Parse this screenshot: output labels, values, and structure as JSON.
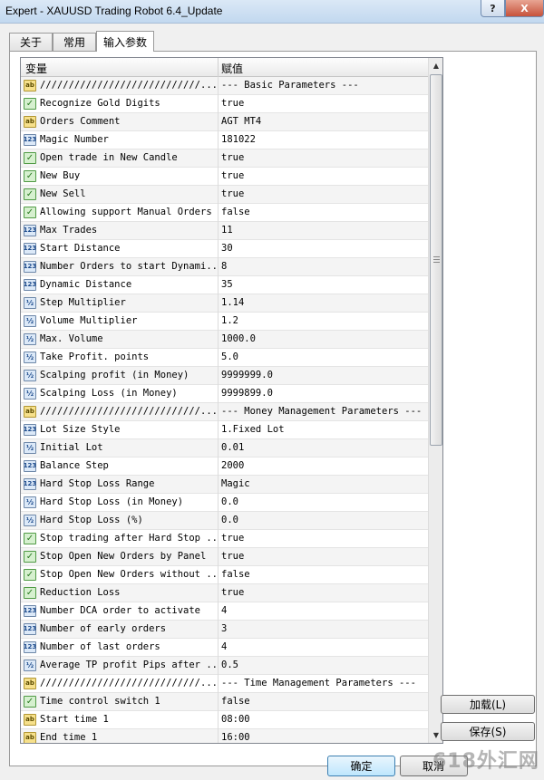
{
  "window": {
    "title": "Expert - XAUUSD Trading Robot 6.4_Update",
    "help_label": "?",
    "close_label": "X"
  },
  "tabs": [
    {
      "label": "关于"
    },
    {
      "label": "常用"
    },
    {
      "label": "输入参数"
    }
  ],
  "table": {
    "columns": [
      "变量",
      "赋值"
    ],
    "rows": [
      {
        "type": "ab",
        "icon": "ab",
        "name": "////////////////////////////...",
        "value": "--- Basic Parameters ---"
      },
      {
        "type": "bool",
        "icon": "✓",
        "name": "Recognize Gold Digits",
        "value": "true"
      },
      {
        "type": "ab",
        "icon": "ab",
        "name": "Orders Comment",
        "value": "AGT MT4"
      },
      {
        "type": "int",
        "icon": "123",
        "name": "Magic Number",
        "value": "181022"
      },
      {
        "type": "bool",
        "icon": "✓",
        "name": "Open trade in New Candle",
        "value": "true"
      },
      {
        "type": "bool",
        "icon": "✓",
        "name": "New Buy",
        "value": "true"
      },
      {
        "type": "bool",
        "icon": "✓",
        "name": "New Sell",
        "value": "true"
      },
      {
        "type": "bool",
        "icon": "✓",
        "name": "Allowing support Manual Orders",
        "value": "false"
      },
      {
        "type": "int",
        "icon": "123",
        "name": "Max Trades",
        "value": "11"
      },
      {
        "type": "int",
        "icon": "123",
        "name": "Start Distance",
        "value": "30"
      },
      {
        "type": "int",
        "icon": "123",
        "name": "Number Orders to start Dynami...",
        "value": "8"
      },
      {
        "type": "int",
        "icon": "123",
        "name": "Dynamic Distance",
        "value": "35"
      },
      {
        "type": "dbl",
        "icon": "½",
        "name": "Step Multiplier",
        "value": "1.14"
      },
      {
        "type": "dbl",
        "icon": "½",
        "name": "Volume Multiplier",
        "value": "1.2"
      },
      {
        "type": "dbl",
        "icon": "½",
        "name": "Max. Volume",
        "value": "1000.0"
      },
      {
        "type": "dbl",
        "icon": "½",
        "name": "Take Profit. points",
        "value": "5.0"
      },
      {
        "type": "dbl",
        "icon": "½",
        "name": "Scalping profit (in Money)",
        "value": "9999999.0"
      },
      {
        "type": "dbl",
        "icon": "½",
        "name": "Scalping Loss (in Money)",
        "value": "9999899.0"
      },
      {
        "type": "ab",
        "icon": "ab",
        "name": "////////////////////////////...",
        "value": "--- Money Management Parameters ---"
      },
      {
        "type": "int",
        "icon": "123",
        "name": "Lot Size Style",
        "value": "1.Fixed Lot"
      },
      {
        "type": "dbl",
        "icon": "½",
        "name": "Initial Lot",
        "value": "0.01"
      },
      {
        "type": "int",
        "icon": "123",
        "name": "Balance Step",
        "value": "2000"
      },
      {
        "type": "int",
        "icon": "123",
        "name": "Hard Stop Loss Range",
        "value": "Magic"
      },
      {
        "type": "dbl",
        "icon": "½",
        "name": "Hard Stop Loss (in Money)",
        "value": "0.0"
      },
      {
        "type": "dbl",
        "icon": "½",
        "name": "Hard Stop Loss (%)",
        "value": "0.0"
      },
      {
        "type": "bool",
        "icon": "✓",
        "name": "Stop trading after Hard Stop ...",
        "value": "true"
      },
      {
        "type": "bool",
        "icon": "✓",
        "name": "Stop Open New Orders by Panel",
        "value": "true"
      },
      {
        "type": "bool",
        "icon": "✓",
        "name": "Stop Open New Orders without ...",
        "value": "false"
      },
      {
        "type": "bool",
        "icon": "✓",
        "name": "Reduction Loss",
        "value": "true"
      },
      {
        "type": "int",
        "icon": "123",
        "name": "Number DCA order to activate",
        "value": "4"
      },
      {
        "type": "int",
        "icon": "123",
        "name": "Number of early orders",
        "value": "3"
      },
      {
        "type": "int",
        "icon": "123",
        "name": "Number of last orders",
        "value": "4"
      },
      {
        "type": "dbl",
        "icon": "½",
        "name": "Average TP profit Pips after ...",
        "value": "0.5"
      },
      {
        "type": "ab",
        "icon": "ab",
        "name": "////////////////////////////...",
        "value": "--- Time Management Parameters ---"
      },
      {
        "type": "bool",
        "icon": "✓",
        "name": "Time control switch 1",
        "value": "false"
      },
      {
        "type": "ab",
        "icon": "ab",
        "name": "Start time 1",
        "value": "08:00"
      },
      {
        "type": "ab",
        "icon": "ab",
        "name": "End time 1",
        "value": "16:00"
      }
    ]
  },
  "buttons": {
    "load": "加载(L)",
    "save": "保存(S)",
    "ok": "确定",
    "cancel": "取消"
  },
  "watermark": "618外汇网",
  "scroll": {
    "up": "▲",
    "down": "▼"
  }
}
